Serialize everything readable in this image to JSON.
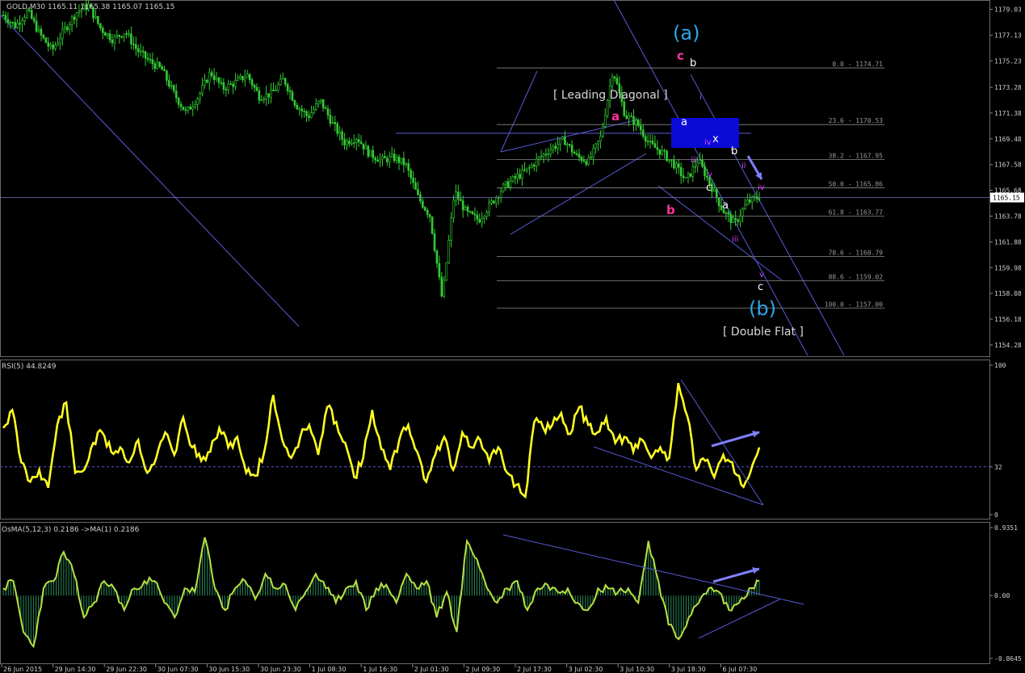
{
  "chart_data": [
    {
      "type": "candlestick",
      "title": "GOLD,M30  1165.11 1165.38 1165.07 1165.15",
      "ylim": [
        1153.5,
        1179.6
      ],
      "y_ticks": [
        1179.03,
        1177.13,
        1175.23,
        1173.28,
        1171.38,
        1169.48,
        1167.58,
        1165.68,
        1163.78,
        1161.88,
        1159.98,
        1158.08,
        1156.18,
        1154.28
      ],
      "current_price": "1165.15",
      "x_ticks": [
        "26 Jun 2015",
        "29 Jun 14:30",
        "29 Jun 22:30",
        "30 Jun 07:30",
        "30 Jun 15:30",
        "30 Jun 23:30",
        "1 Jul 08:30",
        "1 Jul 16:30",
        "2 Jul 01:30",
        "2 Jul 09:30",
        "2 Jul 17:30",
        "3 Jul 02:30",
        "3 Jul 10:30",
        "3 Jul 18:30",
        "6 Jul 07:30"
      ],
      "price_path": [
        1178.6,
        1177.8,
        1178.9,
        1177.2,
        1176.0,
        1177.5,
        1178.8,
        1179.3,
        1177.6,
        1176.8,
        1177.4,
        1176.0,
        1175.2,
        1174.6,
        1172.8,
        1171.4,
        1172.6,
        1174.4,
        1173.2,
        1173.6,
        1174.2,
        1172.6,
        1172.8,
        1173.9,
        1172.0,
        1171.1,
        1172.3,
        1170.6,
        1169.2,
        1169.6,
        1168.4,
        1167.9,
        1168.1,
        1167.6,
        1165.2,
        1163.8,
        1157.6,
        1165.6,
        1164.0,
        1163.5,
        1164.7,
        1165.9,
        1166.6,
        1167.2,
        1168.1,
        1168.8,
        1169.4,
        1168.2,
        1167.8,
        1169.6,
        1174.6,
        1171.2,
        1170.6,
        1169.1,
        1168.5,
        1167.6,
        1166.4,
        1167.9,
        1166.1,
        1164.2,
        1163.2,
        1164.8,
        1165.2
      ],
      "fib_levels": [
        {
          "label": "0.0 - 1174.71",
          "value": 1174.71
        },
        {
          "label": "23.6 - 1170.53",
          "value": 1170.53
        },
        {
          "label": "38.2 - 1167.95",
          "value": 1167.95
        },
        {
          "label": "50.0 - 1165.86",
          "value": 1165.86
        },
        {
          "label": "61.8 - 1163.77",
          "value": 1163.77
        },
        {
          "label": "78.6 - 1160.79",
          "value": 1160.79
        },
        {
          "label": "88.6 - 1159.02",
          "value": 1159.02
        },
        {
          "label": "100.0 - 1157.00",
          "value": 1157.0
        }
      ],
      "annotations": {
        "wave_a_big": "(a)",
        "wave_b_big": "(b)",
        "leading_diagonal": "[ Leading Diagonal ]",
        "double_flat": "[ Double Flat ]",
        "c_pink": "c",
        "a_pink": "a",
        "b_pink": "b",
        "b_white_top": "b",
        "a_white": "a",
        "x_white": "x",
        "b_white": "b",
        "c_white": "c",
        "a_white2": "a",
        "c_white2": "c",
        "i_m": "i",
        "ii_m": "ii",
        "iii_m": "iii",
        "iv_m": "iv",
        "v_m": "v",
        "iii_m2": "iii",
        "iv_m2": "iv",
        "v_m2": "v",
        "ii_m2": "ii",
        "iii_m3": "iii"
      }
    },
    {
      "type": "line",
      "title": "RSI(5) 44.8249",
      "ylim": [
        0,
        100
      ],
      "y_ticks": [
        100,
        32,
        0
      ],
      "level": 32,
      "values": [
        58,
        70,
        35,
        22,
        30,
        18,
        60,
        75,
        28,
        30,
        48,
        55,
        42,
        45,
        35,
        50,
        28,
        38,
        55,
        40,
        65,
        45,
        36,
        42,
        58,
        45,
        52,
        28,
        26,
        42,
        80,
        50,
        38,
        52,
        60,
        40,
        72,
        62,
        48,
        25,
        38,
        70,
        44,
        30,
        50,
        60,
        42,
        22,
        40,
        52,
        30,
        55,
        45,
        50,
        35,
        45,
        28,
        20,
        12,
        62,
        58,
        60,
        68,
        54,
        72,
        60,
        55,
        65,
        48,
        52,
        42,
        50,
        38,
        45,
        38,
        88,
        66,
        30,
        36,
        25,
        40,
        35,
        20,
        28,
        45
      ]
    },
    {
      "type": "bar",
      "title": "OsMA(5,12,3) 0.2186  ->MA(1) 0.2186",
      "ylim": [
        -0.8645,
        0.9351
      ],
      "y_ticks": [
        "0.9351",
        "0.00",
        "-0.8645"
      ],
      "values": [
        0.1,
        0.2,
        -0.5,
        -0.7,
        0.1,
        0.2,
        0.6,
        0.3,
        -0.3,
        -0.1,
        0.2,
        0.1,
        -0.2,
        0.1,
        0.2,
        0.2,
        -0.1,
        -0.3,
        0.1,
        0.05,
        0.8,
        0.1,
        -0.2,
        0.1,
        0.2,
        -0.05,
        0.3,
        0.1,
        0.15,
        -0.2,
        0.05,
        0.3,
        0.1,
        -0.1,
        0.1,
        0.2,
        -0.2,
        0.1,
        0.15,
        -0.1,
        0.3,
        0.1,
        0.2,
        -0.3,
        0.05,
        -0.5,
        0.75,
        0.5,
        0.1,
        -0.1,
        0.1,
        0.2,
        -0.2,
        0.1,
        0.15,
        0.05,
        0.1,
        -0.1,
        -0.2,
        0.1,
        0.1,
        0.05,
        0.1,
        -0.1,
        0.75,
        0.2,
        -0.4,
        -0.6,
        -0.3,
        -0.1,
        0.1,
        0.05,
        -0.2,
        -0.1,
        0.1,
        0.2
      ]
    }
  ]
}
